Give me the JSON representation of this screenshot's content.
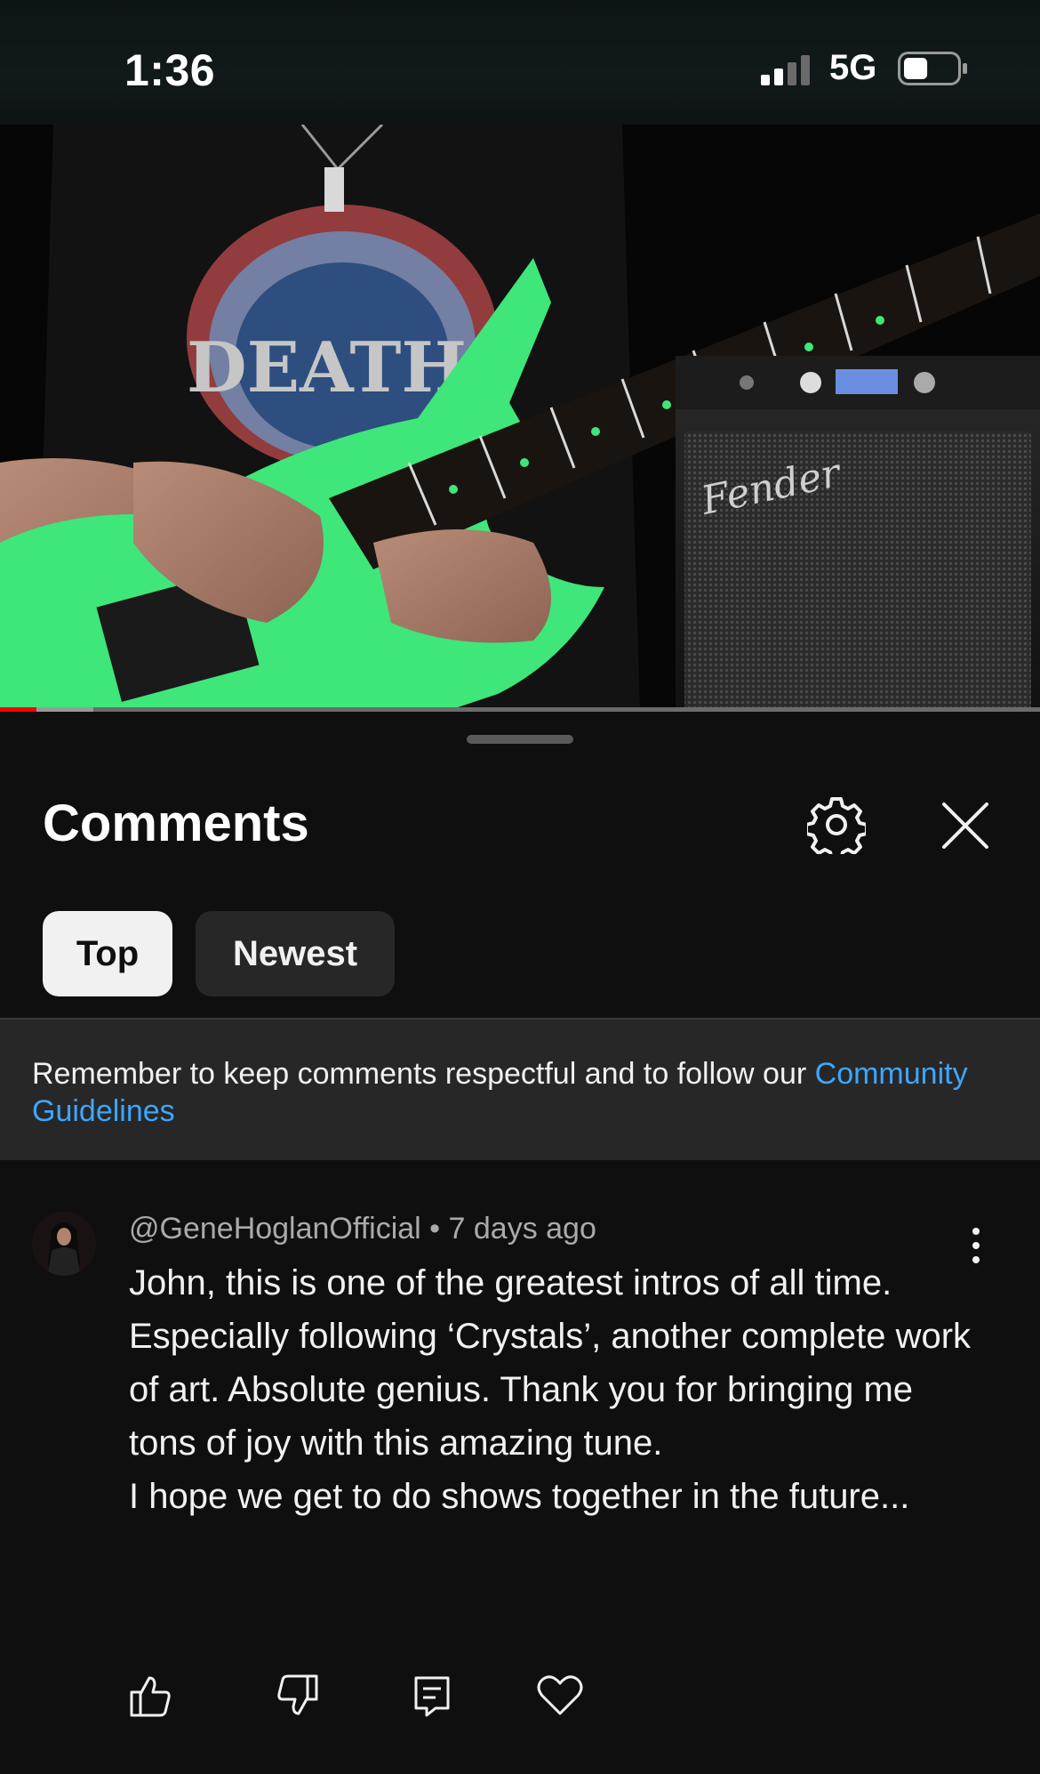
{
  "status_bar": {
    "time": "1:36",
    "network": "5G",
    "signal_bars_active": 2,
    "signal_bars_total": 4,
    "battery_level_fraction": 0.45
  },
  "video": {
    "progress_fraction": 0.035,
    "buffered_fraction": 0.09,
    "amp_logo_text": "Fender",
    "shirt_text": "DEATH"
  },
  "comments_panel": {
    "title": "Comments",
    "settings_icon": "gear-icon",
    "close_icon": "close-icon",
    "filters": [
      {
        "label": "Top",
        "selected": true
      },
      {
        "label": "Newest",
        "selected": false
      }
    ],
    "notice": {
      "text": "Remember to keep comments respectful and to follow our ",
      "link": "Community Guidelines"
    }
  },
  "comment": {
    "author": "@GeneHoglanOfficial",
    "separator": " • ",
    "time_ago": "7 days ago",
    "text": "John, this is one of the greatest intros of all time. Especially following ‘Crystals’, another complete work of art. Absolute genius. Thank you for bringing me tons of joy with this amazing tune.\nI hope we get to do shows together in the future...",
    "actions": [
      "like-icon",
      "dislike-icon",
      "reply-icon",
      "heart-icon"
    ]
  },
  "colors": {
    "background": "#0f0f0f",
    "chip_selected": "#f1f1f1",
    "chip_unselected": "#272727",
    "link": "#3ea6ff",
    "progress": "#ff0000",
    "guitar": "#3fe67a"
  }
}
